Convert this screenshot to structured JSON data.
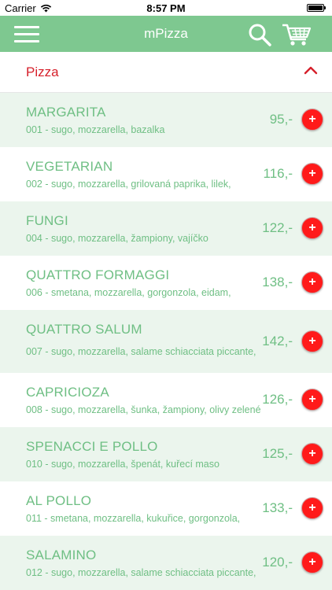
{
  "status_bar": {
    "carrier": "Carrier",
    "time": "8:57 PM"
  },
  "nav": {
    "title": "mPizza"
  },
  "section": {
    "title": "Pizza"
  },
  "colors": {
    "accent": "#7ec890",
    "text_green": "#6fbf84",
    "category_red": "#d6202b",
    "add_button": "#ff1a1a"
  },
  "items": [
    {
      "name": "MARGARITA",
      "desc": "001 - sugo, mozzarella, bazalka",
      "price": "95,-"
    },
    {
      "name": "VEGETARIAN",
      "desc": "002 - sugo, mozzarella, grilovaná paprika, lilek,",
      "price": "116,-"
    },
    {
      "name": "FUNGI",
      "desc": "004 - sugo, mozzarella, žampiony, vajíčko",
      "price": "122,-"
    },
    {
      "name": "QUATTRO FORMAGGI",
      "desc": "006 - smetana, mozzarella, gorgonzola, eidam,",
      "price": "138,-"
    },
    {
      "name": "QUATTRO SALUM",
      "desc": "007 - sugo, mozzarella, salame schiacciata piccante,",
      "price": "142,-"
    },
    {
      "name": "CAPRICIOZA",
      "desc": "008 - sugo, mozzarella, šunka, žampiony, olivy zelené",
      "price": "126,-"
    },
    {
      "name": "SPENACCI E POLLO",
      "desc": "010 - sugo, mozzarella, špenát, kuřecí maso",
      "price": "125,-"
    },
    {
      "name": "AL POLLO",
      "desc": "011 - smetana, mozzarella, kukuřice, gorgonzola,",
      "price": "133,-"
    },
    {
      "name": "SALAMINO",
      "desc": "012 - sugo, mozzarella, salame schiacciata piccante,",
      "price": "120,-"
    }
  ],
  "add_button_label": "+"
}
